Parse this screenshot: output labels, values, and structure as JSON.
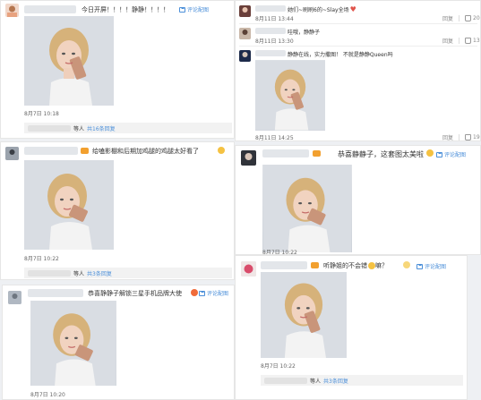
{
  "comments": [
    {
      "id": "c1",
      "text": "今日开屏！！！！静静！！！！",
      "view_image": "评论配图",
      "time": "8月7日 10:18",
      "reply_prefix": "等人",
      "reply_link": "共16条回复"
    },
    {
      "id": "c2",
      "text": "给嗑影棚和后期加鸡腿的鸡腿太好看了",
      "view_image": "评论配图",
      "time": "8月7日 10:22",
      "reply_prefix": "等人",
      "reply_link": "共3条回复"
    },
    {
      "id": "c3",
      "text": "恭喜静静子解锁三星手机品牌大使",
      "view_image": "评论配图",
      "time": "8月7日 10:20"
    },
    {
      "id": "c4",
      "text": "她们~刷刷6的~Slay全场",
      "time": "8月11日 13:44",
      "reply_label": "回复",
      "likes": "20"
    },
    {
      "id": "c5",
      "text": "哇哦，静静子",
      "time": "8月11日 13:30",
      "reply_label": "回复",
      "likes": "13"
    },
    {
      "id": "c6",
      "text": "静静在线，实力撒图！ 不就是静静Queen吗",
      "time": "8月11日 14:25",
      "reply_label": "回复",
      "likes": "19"
    },
    {
      "id": "c7",
      "text": "恭喜静静子，这套图太美啦",
      "view_image": "评论配图",
      "time": "8月7日 10:22"
    },
    {
      "id": "c8",
      "text": "听静姐的不会错",
      "text_suffix": "嘛？",
      "view_image": "评论配图",
      "time": "8月7日 10:22",
      "reply_prefix": "等人",
      "reply_link": "共3条回复"
    }
  ]
}
